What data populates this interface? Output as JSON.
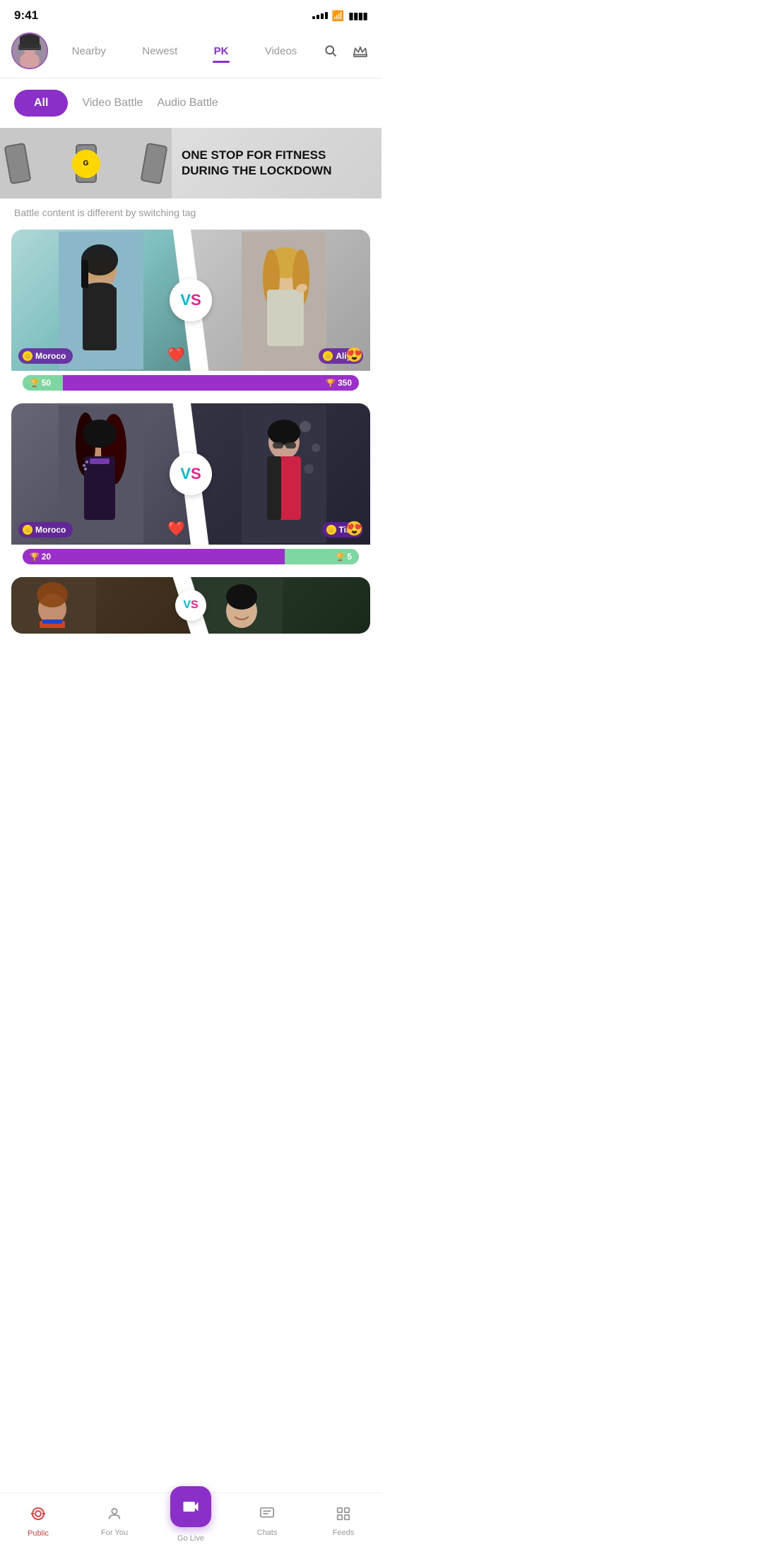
{
  "statusBar": {
    "time": "9:41",
    "signalBars": [
      3,
      5,
      7,
      9,
      11
    ],
    "wifi": "wifi",
    "battery": "battery"
  },
  "header": {
    "navItems": [
      {
        "id": "nearby",
        "label": "Nearby",
        "active": false
      },
      {
        "id": "newest",
        "label": "Newest",
        "active": false
      },
      {
        "id": "pk",
        "label": "PK",
        "active": true
      },
      {
        "id": "videos",
        "label": "Videos",
        "active": false
      }
    ],
    "searchIcon": "search",
    "crownIcon": "crown"
  },
  "filterTabs": {
    "all": {
      "label": "All",
      "active": true
    },
    "videoBattle": {
      "label": "Video Battle",
      "active": false
    },
    "audioBattle": {
      "label": "Audio Battle",
      "active": false
    }
  },
  "banner": {
    "text": "ONE STOP FOR FITNESS DURING THE LOCKDOWN",
    "logoText": "G"
  },
  "subtitle": "Battle content is different by switching tag",
  "battleCards": [
    {
      "id": "battle1",
      "leftUser": {
        "name": "Moroco",
        "emoji": "😍"
      },
      "rightUser": {
        "name": "Aliya",
        "emoji": "❤️"
      },
      "leftScore": 50,
      "rightScore": 350,
      "leftPercent": 12
    },
    {
      "id": "battle2",
      "leftUser": {
        "name": "Moroco",
        "emoji": "😍"
      },
      "rightUser": {
        "name": "Tina",
        "emoji": "❤️"
      },
      "leftScore": 20,
      "rightScore": 5,
      "leftPercent": 78
    }
  ],
  "bottomNav": {
    "tabs": [
      {
        "id": "public",
        "label": "Public",
        "icon": "📡",
        "active": true
      },
      {
        "id": "foryou",
        "label": "For You",
        "icon": "👤",
        "active": false
      },
      {
        "id": "golive",
        "label": "Go Live",
        "icon": "golive",
        "active": false
      },
      {
        "id": "chats",
        "label": "Chats",
        "icon": "💬",
        "active": false
      },
      {
        "id": "feeds",
        "label": "Feeds",
        "icon": "📋",
        "active": false
      }
    ]
  }
}
